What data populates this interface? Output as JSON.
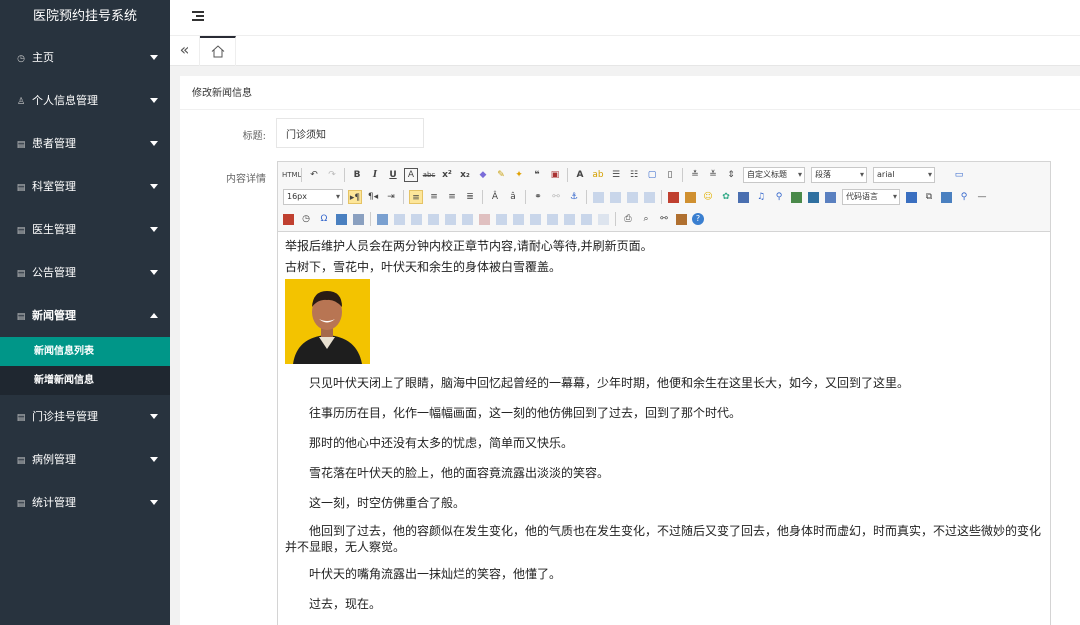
{
  "app": {
    "title": "医院预约挂号系统"
  },
  "sidebar": {
    "items": [
      {
        "label": "主页"
      },
      {
        "label": "个人信息管理"
      },
      {
        "label": "患者管理"
      },
      {
        "label": "科室管理"
      },
      {
        "label": "医生管理"
      },
      {
        "label": "公告管理"
      },
      {
        "label": "新闻管理",
        "expanded": true,
        "children": [
          {
            "label": "新闻信息列表",
            "active": true
          },
          {
            "label": "新增新闻信息"
          }
        ]
      },
      {
        "label": "门诊挂号管理"
      },
      {
        "label": "病例管理"
      },
      {
        "label": "统计管理"
      }
    ]
  },
  "colors": {
    "sidebar_bg": "#28333e",
    "active": "#009688",
    "accent_btn": "#fde69a"
  },
  "form": {
    "heading": "修改新闻信息",
    "title_label": "标题:",
    "title_value": "门诊须知",
    "content_label": "内容详情"
  },
  "editor": {
    "toolbar": {
      "fontsize": "16px",
      "custom_heading": "自定义标题",
      "paragraph": "段落",
      "font": "arial",
      "code_lang": "代码语言",
      "bold": "B",
      "italic": "I",
      "underline": "U",
      "html": "HTML"
    },
    "content": {
      "line1": "举报后维护人员会在两分钟内校正章节内容,请耐心等待,并刷新页面。",
      "line2": "古树下，雪花中，叶伏天和余生的身体被白雪覆盖。",
      "paragraphs": [
        "只见叶伏天闭上了眼睛，脑海中回忆起曾经的一幕幕，少年时期，他便和余生在这里长大，如今，又回到了这里。",
        "往事历历在目，化作一幅幅画面，这一刻的他仿佛回到了过去，回到了那个时代。",
        "那时的他心中还没有太多的忧虑，简单而又快乐。",
        "雪花落在叶伏天的脸上，他的面容竟流露出淡淡的笑容。",
        "这一刻，时空仿佛重合了般。",
        "他回到了过去，他的容颜似在发生变化，他的气质也在发生变化，不过随后又变了回去，他身体时而虚幻，时而真实，不过这些微妙的变化并不显眼，无人察觉。",
        "叶伏天的嘴角流露出一抹灿烂的笑容，他懂了。",
        "过去，现在。"
      ]
    }
  }
}
